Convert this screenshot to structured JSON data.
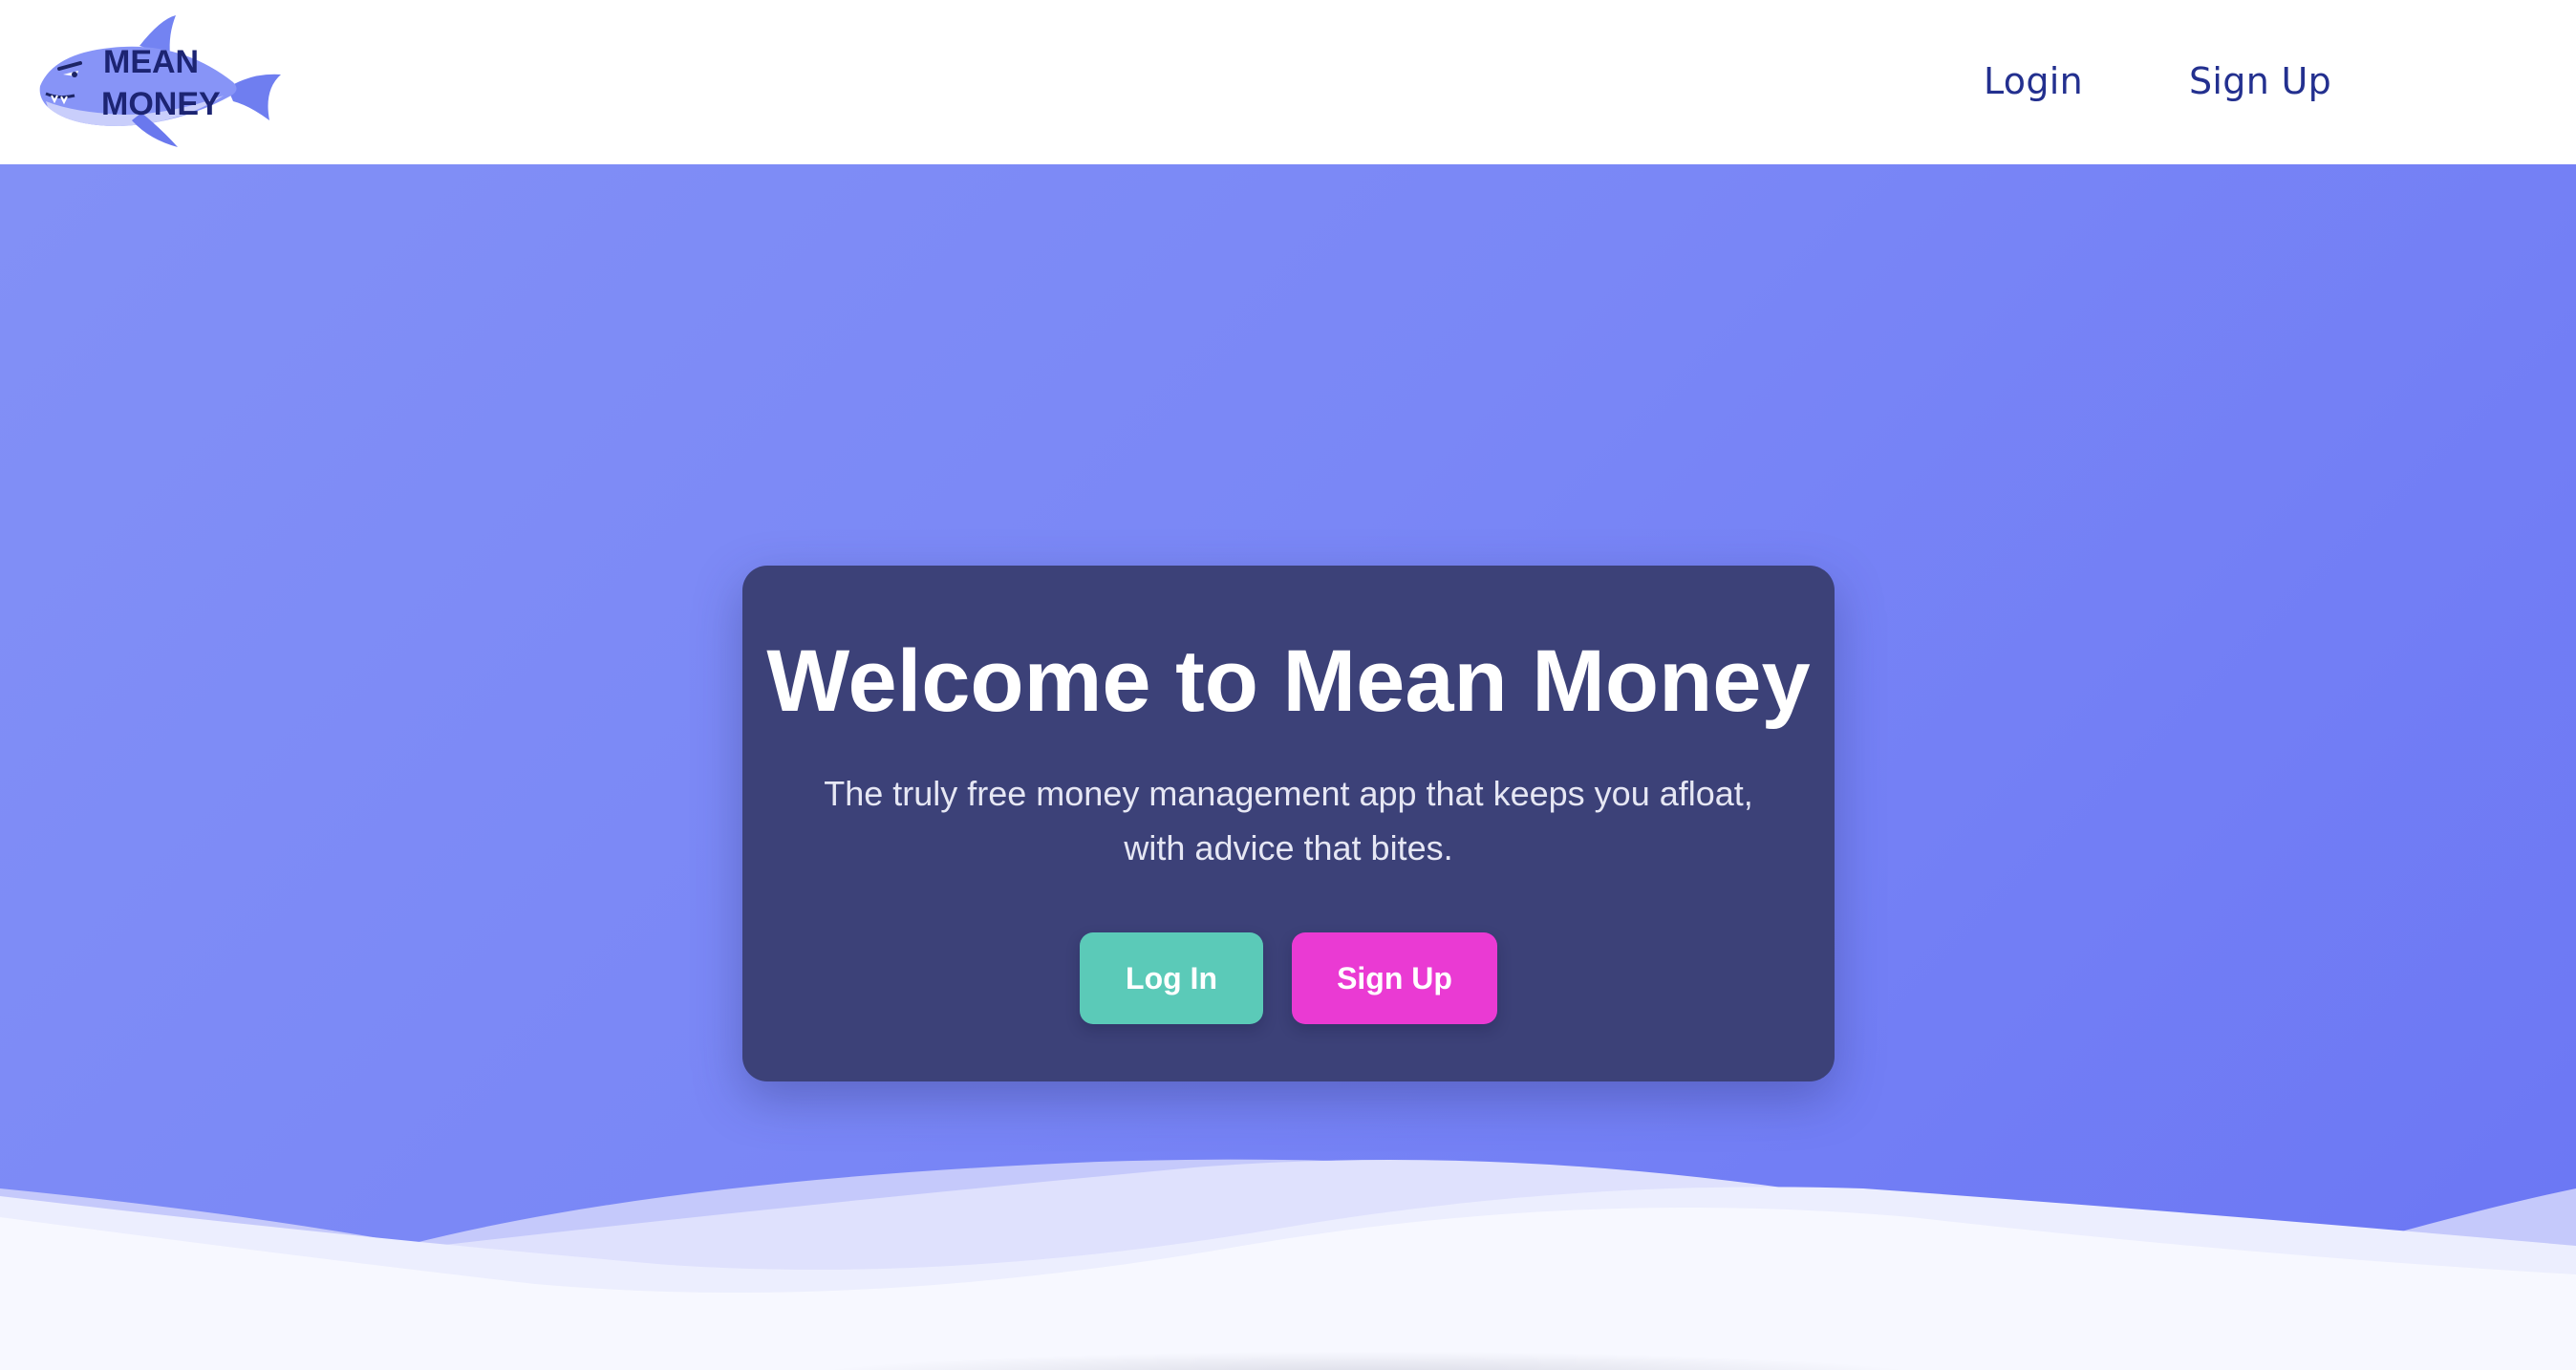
{
  "brand": {
    "logo_line1": "MEAN",
    "logo_line2": "MONEY",
    "logo_alt": "Mean Money"
  },
  "nav": {
    "login_label": "Login",
    "signup_label": "Sign Up"
  },
  "hero": {
    "title": "Welcome to Mean Money",
    "subtitle_line1": "The truly free money management app that keeps you afloat,",
    "subtitle_line2": "with advice that bites.",
    "login_button": "Log In",
    "signup_button": "Sign Up"
  },
  "colors": {
    "nav_text": "#23308f",
    "hero_gradient_start": "#8290f6",
    "hero_gradient_end": "#6b76f4",
    "card_bg": "#3c4178",
    "login_button_bg": "#5bcab8",
    "signup_button_bg": "#ea3ad3"
  }
}
